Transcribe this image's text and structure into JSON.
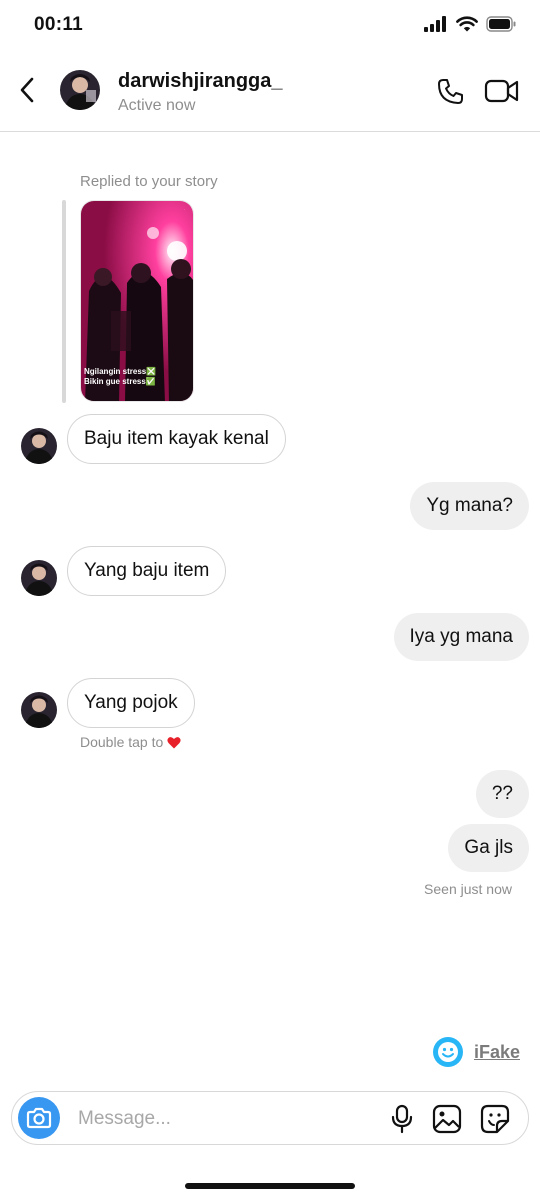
{
  "status_bar": {
    "time": "00:11"
  },
  "header": {
    "username": "darwishjirangga_",
    "status": "Active now"
  },
  "story_reply": {
    "label": "Replied to your story",
    "caption_line1": "Ngilangin stress❎",
    "caption_line2": "Bikin gue stress✅"
  },
  "messages": [
    {
      "from": "them",
      "text": "Baju item kayak kenal"
    },
    {
      "from": "me",
      "text": "Yg mana?"
    },
    {
      "from": "them",
      "text": "Yang baju item"
    },
    {
      "from": "me",
      "text": "Iya yg mana"
    },
    {
      "from": "them",
      "text": "Yang pojok"
    },
    {
      "from": "me",
      "text": "??"
    },
    {
      "from": "me",
      "text": "Ga jls"
    }
  ],
  "hint": "Double tap to",
  "seen": "Seen just now",
  "watermark": "iFake",
  "composer": {
    "placeholder": "Message..."
  },
  "colors": {
    "accent": "#3897f0",
    "story_pink": "#e0246e",
    "heart": "#e8202a"
  }
}
